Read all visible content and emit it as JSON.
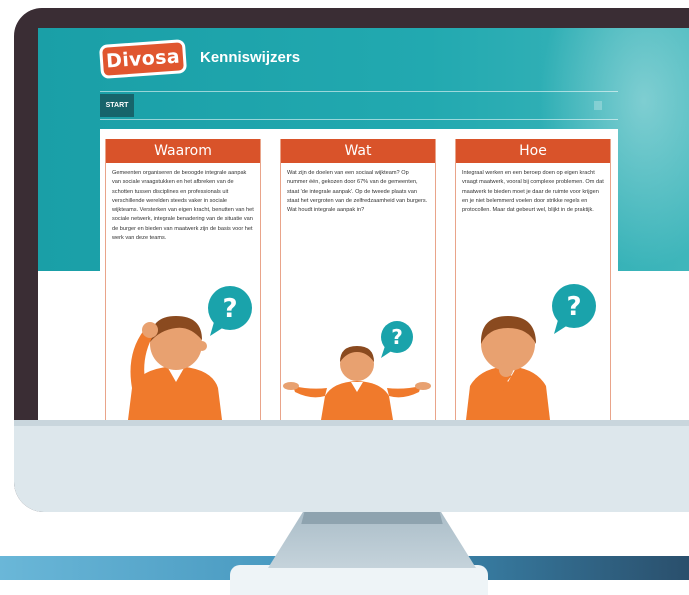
{
  "site": {
    "logo_text": "Divosa",
    "title": "Kenniswijzers"
  },
  "nav": {
    "start_label": "START"
  },
  "columns": [
    {
      "heading": "Waarom",
      "text": "Gemeenten organiseren de beoogde integrale aanpak van sociale vraagstukken en het afbreken van de schotten tussen disciplines en professionals uit verschillende werelden steeds vaker in sociale wijkteams. Versterken van eigen kracht, benutten van het sociale netwerk, integrale benadering van de situatie van de burger en bieden van maatwerk zijn de basis voor het werk van deze teams.",
      "figure": "scratching-head-person",
      "bubble": "?"
    },
    {
      "heading": "Wat",
      "text": "Wat zijn de doelen van een sociaal wijkteam? Op nummer één, gekozen door 67% van de gemeenten, staat 'de integrale aanpak'. Op de tweede plaats van staat het vergroten van de zelfredzaamheid van burgers. Wat houdt integrale aanpak in?",
      "figure": "shrugging-person",
      "bubble": "?"
    },
    {
      "heading": "Hoe",
      "text": "Integraal werken en een beroep doen op eigen kracht vraagt maatwerk, vooral bij complexe problemen. Om dat maatwerk te bieden moet je daar de ruimte voor krijgen en je niet belemmerd voelen door strikke regels en protocollen. Maar dat gebeurt wel, blijkt in de praktijk.",
      "figure": "chin-hand-person",
      "bubble": "?"
    }
  ],
  "colors": {
    "brand_teal": "#1a9fa7",
    "accent_orange": "#d9532a",
    "bubble_teal": "#1aa3ab",
    "shirt_orange": "#f07a2c",
    "monitor_frame": "#3a2d34"
  }
}
